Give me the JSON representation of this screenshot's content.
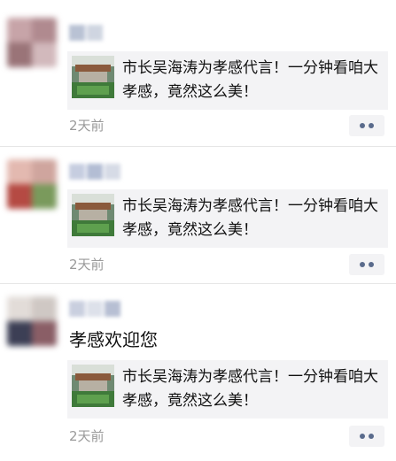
{
  "colors": {
    "link_dots": "#5a6b8c",
    "card_bg": "#f3f3f5",
    "time_text": "#9a9a9a"
  },
  "posts": [
    {
      "text": "",
      "share": {
        "title": "市长吴海涛为孝感代言！一分钟看咱大孝感，竟然这么美！"
      },
      "time": "2天前",
      "more_icon": "more-dots-icon"
    },
    {
      "text": "",
      "share": {
        "title": "市长吴海涛为孝感代言！一分钟看咱大孝感，竟然这么美！"
      },
      "time": "2天前",
      "more_icon": "more-dots-icon"
    },
    {
      "text": "孝感欢迎您",
      "share": {
        "title": "市长吴海涛为孝感代言！一分钟看咱大孝感，竟然这么美！"
      },
      "time": "2天前",
      "more_icon": "more-dots-icon"
    }
  ]
}
